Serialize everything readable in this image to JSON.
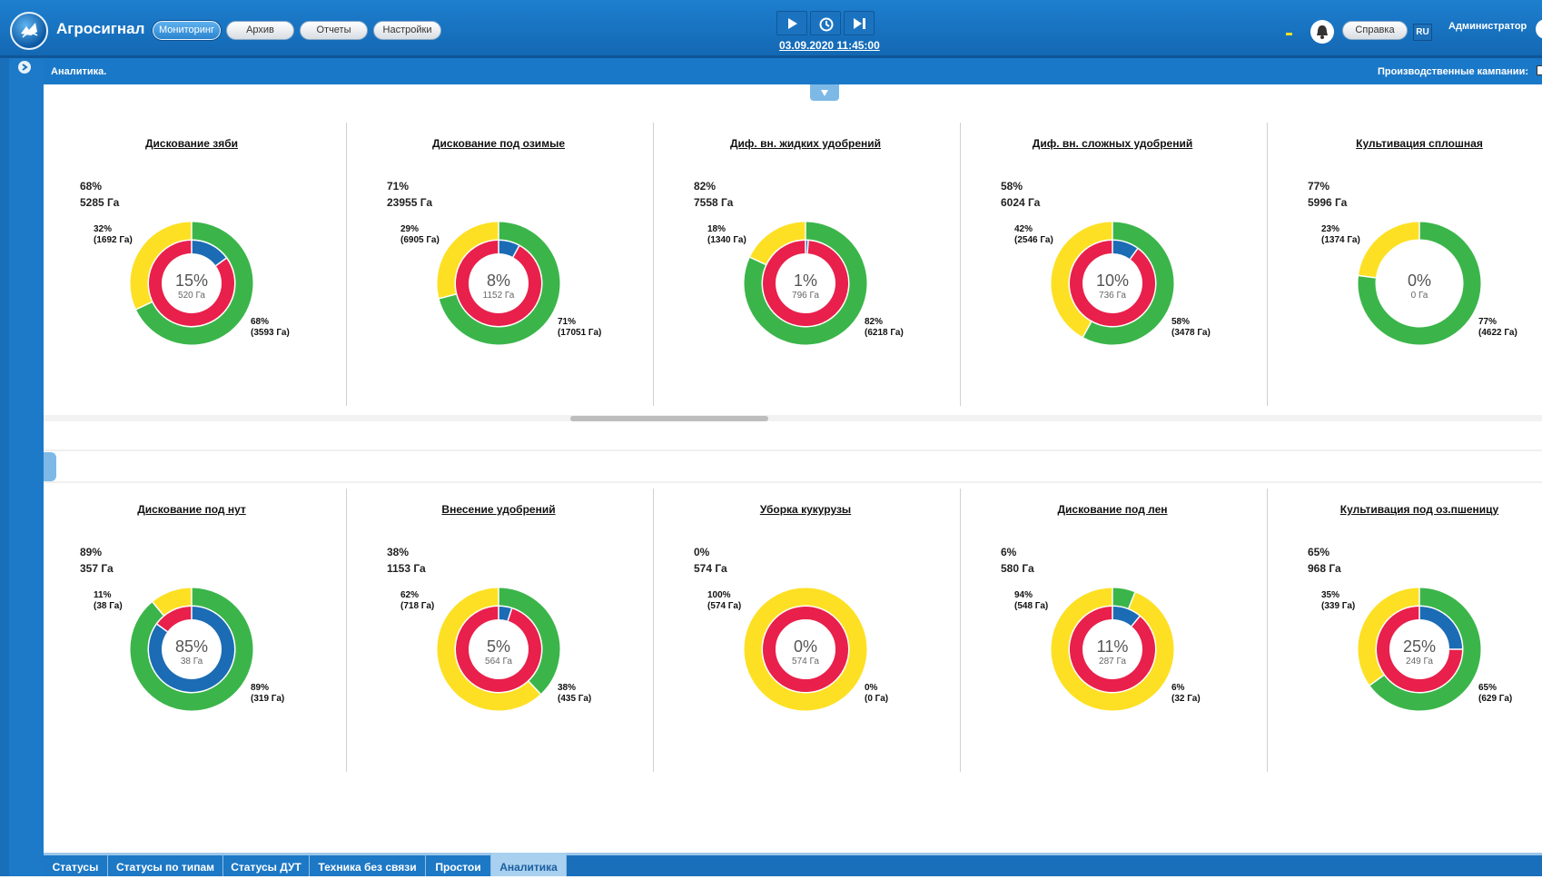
{
  "app": {
    "title": "Агросигнал",
    "nav": [
      "Мониторинг",
      "Архив",
      "Отчеты",
      "Настройки"
    ],
    "active_nav": "Мониторинг",
    "datetime": "03.09.2020 11:45:00",
    "help": "Справка",
    "lang": "RU",
    "user": "Администратор"
  },
  "header": {
    "section": "Аналитика.",
    "campaigns_label": "Производственные кампании:"
  },
  "colors": {
    "green": "#3bb54a",
    "yellow": "#fde024",
    "blue": "#1b6cb5",
    "red": "#e8204b"
  },
  "icons": [
    "app-logo-icon",
    "play-icon",
    "history-icon",
    "skip-end-icon",
    "bell-icon",
    "expand-icon",
    "collapse-down-icon",
    "user-icon"
  ],
  "charts": [
    {
      "title": "Дискование зяби",
      "pct": "68%",
      "ha": "5285 Га",
      "center_pct": "15%",
      "center_ha": "520 Га",
      "outer": [
        68,
        32
      ],
      "inner": [
        15,
        85
      ],
      "label_a": [
        "32%",
        "(1692 Га)"
      ],
      "label_b": [
        "68%",
        "(3593 Га)"
      ]
    },
    {
      "title": "Дискование под озимые",
      "pct": "71%",
      "ha": "23955 Га",
      "center_pct": "8%",
      "center_ha": "1152 Га",
      "outer": [
        71,
        29
      ],
      "inner": [
        8,
        92
      ],
      "label_a": [
        "29%",
        "(6905 Га)"
      ],
      "label_b": [
        "71%",
        "(17051 Га)"
      ]
    },
    {
      "title": "Диф. вн. жидких удобрений",
      "pct": "82%",
      "ha": "7558 Га",
      "center_pct": "1%",
      "center_ha": "796 Га",
      "outer": [
        82,
        18
      ],
      "inner": [
        1,
        99
      ],
      "label_a": [
        "18%",
        "(1340 Га)"
      ],
      "label_b": [
        "82%",
        "(6218 Га)"
      ]
    },
    {
      "title": "Диф. вн. сложных удобрений",
      "pct": "58%",
      "ha": "6024 Га",
      "center_pct": "10%",
      "center_ha": "736 Га",
      "outer": [
        58,
        42
      ],
      "inner": [
        10,
        90
      ],
      "label_a": [
        "42%",
        "(2546 Га)"
      ],
      "label_b": [
        "58%",
        "(3478 Га)"
      ]
    },
    {
      "title": "Культивация сплошная",
      "pct": "77%",
      "ha": "5996 Га",
      "center_pct": "0%",
      "center_ha": "0 Га",
      "outer": [
        77,
        23
      ],
      "inner": [
        0,
        0
      ],
      "label_a": [
        "23%",
        "(1374 Га)"
      ],
      "label_b": [
        "77%",
        "(4622 Га)"
      ]
    },
    {
      "title": "Дискование под нут",
      "pct": "89%",
      "ha": "357 Га",
      "center_pct": "85%",
      "center_ha": "38 Га",
      "outer": [
        89,
        11
      ],
      "inner": [
        85,
        15
      ],
      "label_a": [
        "11%",
        "(38 Га)"
      ],
      "label_b": [
        "89%",
        "(319 Га)"
      ]
    },
    {
      "title": "Внесение удобрений",
      "pct": "38%",
      "ha": "1153 Га",
      "center_pct": "5%",
      "center_ha": "564 Га",
      "outer": [
        38,
        62
      ],
      "inner": [
        5,
        95
      ],
      "label_a": [
        "62%",
        "(718 Га)"
      ],
      "label_b": [
        "38%",
        "(435 Га)"
      ]
    },
    {
      "title": "Уборка кукурузы",
      "pct": "0%",
      "ha": "574 Га",
      "center_pct": "0%",
      "center_ha": "574 Га",
      "outer": [
        0,
        100
      ],
      "inner": [
        0,
        100
      ],
      "label_a": [
        "100%",
        "(574 Га)"
      ],
      "label_b": [
        "0%",
        "(0 Га)"
      ]
    },
    {
      "title": "Дискование под лен",
      "pct": "6%",
      "ha": "580 Га",
      "center_pct": "11%",
      "center_ha": "287 Га",
      "outer": [
        6,
        94
      ],
      "inner": [
        11,
        89
      ],
      "label_a": [
        "94%",
        "(548 Га)"
      ],
      "label_b": [
        "6%",
        "(32 Га)"
      ]
    },
    {
      "title": "Культивация под оз.пшеницу",
      "pct": "65%",
      "ha": "968 Га",
      "center_pct": "25%",
      "center_ha": "249 Га",
      "outer": [
        65,
        35
      ],
      "inner": [
        25,
        75
      ],
      "label_a": [
        "35%",
        "(339 Га)"
      ],
      "label_b": [
        "65%",
        "(629 Га)"
      ]
    }
  ],
  "tabs": [
    "Статусы",
    "Статусы по типам",
    "Статусы ДУТ",
    "Техника без связи",
    "Простои",
    "Аналитика"
  ],
  "active_tab": "Аналитика"
}
